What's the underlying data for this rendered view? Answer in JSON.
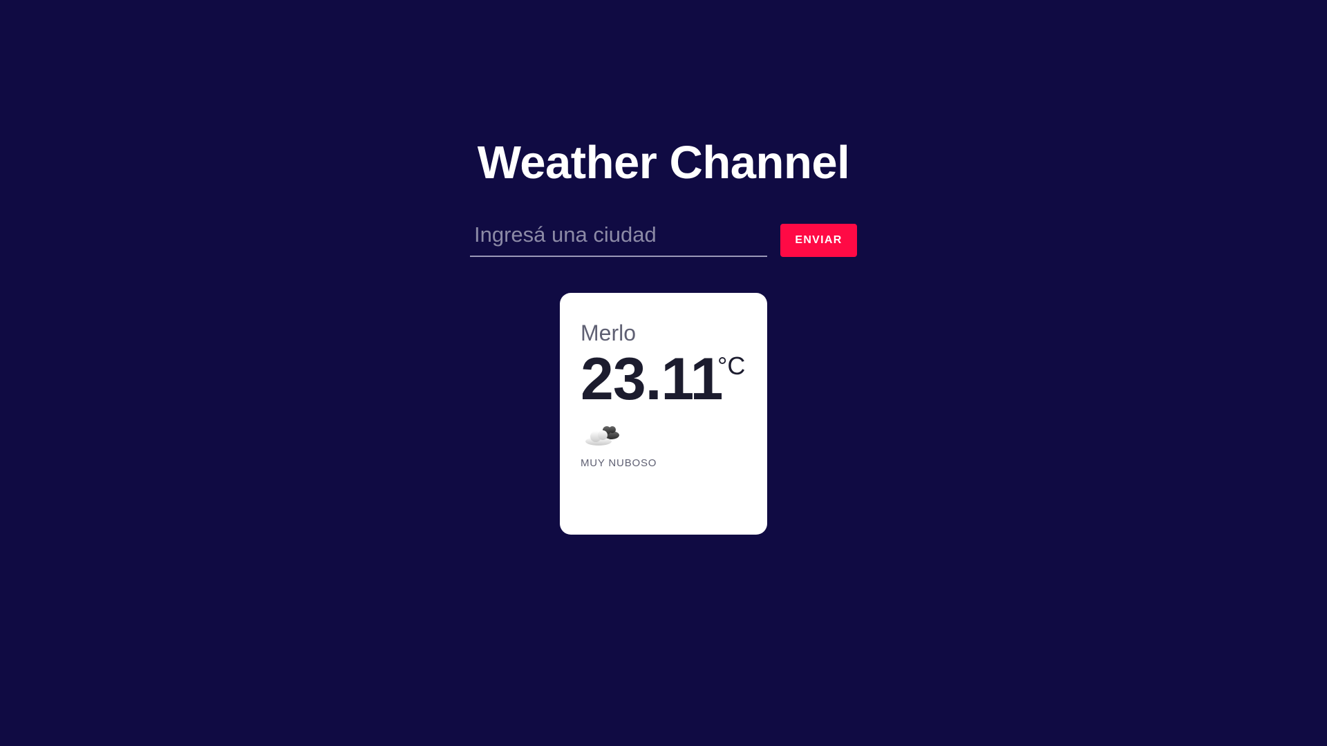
{
  "header": {
    "title": "Weather Channel"
  },
  "search": {
    "placeholder": "Ingresá una ciudad",
    "value": "",
    "submit_label": "ENVIAR"
  },
  "weather_card": {
    "city": "Merlo",
    "temperature": "23.11",
    "unit": "°C",
    "icon": "cloudy-icon",
    "condition": "MUY NUBOSO"
  },
  "colors": {
    "background": "#100b43",
    "accent": "#ff0a45",
    "card": "#ffffff"
  }
}
